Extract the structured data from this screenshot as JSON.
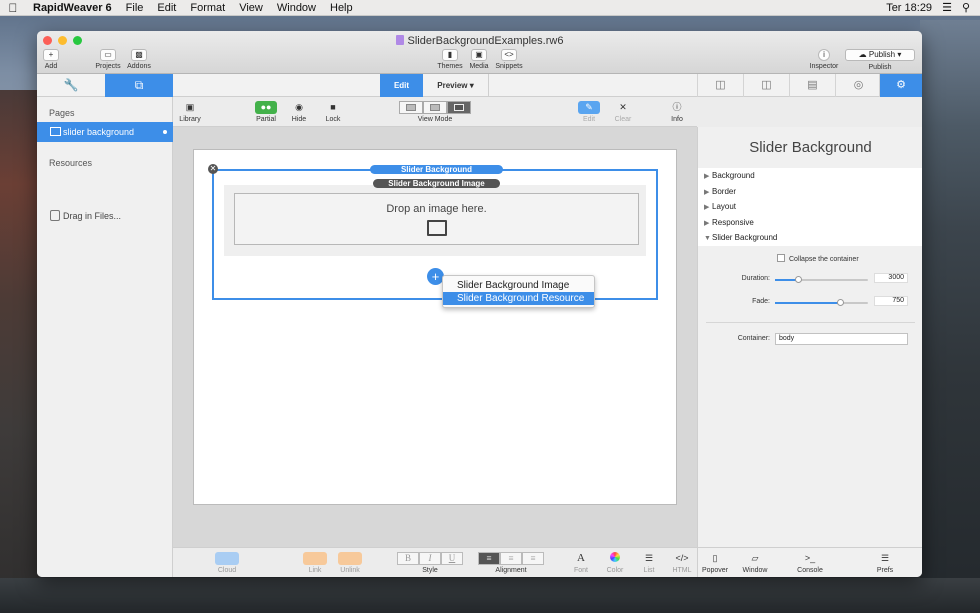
{
  "menubar": {
    "app": "RapidWeaver 6",
    "items": [
      "File",
      "Edit",
      "Format",
      "View",
      "Window",
      "Help"
    ],
    "clock": "Ter 18:29"
  },
  "window": {
    "title": "SliderBackgroundExamples.rw6"
  },
  "toolbar": {
    "add": "Add",
    "projects": "Projects",
    "addons": "Addons",
    "themes": "Themes",
    "media": "Media",
    "snippets": "Snippets",
    "inspector": "Inspector",
    "publish_btn": "Publish",
    "publish": "Publish"
  },
  "modes": {
    "edit": "Edit",
    "preview": "Preview"
  },
  "edit_toolbar": {
    "library": "Library",
    "partial": "Partial",
    "hide": "Hide",
    "lock": "Lock",
    "view_mode": "View Mode",
    "edit": "Edit",
    "clear": "Clear",
    "info": "Info"
  },
  "sidebar": {
    "pages_header": "Pages",
    "page_item": "slider background",
    "resources_header": "Resources",
    "drag_files": "Drag in Files..."
  },
  "canvas": {
    "stack_label": "Slider Background",
    "image_label": "Slider Background Image",
    "drop_text": "Drop an image here.",
    "plus": "+",
    "menu": [
      "Slider Background Image",
      "Slider Background Resource"
    ]
  },
  "bottom": {
    "cloud": "Cloud",
    "link": "Link",
    "unlink": "Unlink",
    "style": "Style",
    "bold": "B",
    "italic": "I",
    "underline": "U",
    "alignment": "Alignment",
    "font": "Font",
    "color": "Color",
    "list": "List",
    "html": "HTML"
  },
  "inspector": {
    "title": "Slider Background",
    "sections": [
      "Background",
      "Border",
      "Layout",
      "Responsive",
      "Slider Background"
    ],
    "collapse": "Collapse the container",
    "duration_label": "Duration:",
    "duration_value": "3000",
    "duration_level": 0.25,
    "fade_label": "Fade:",
    "fade_value": "750",
    "fade_level": 0.7,
    "container_label": "Container:",
    "container_value": "body",
    "popover": "Popover",
    "window": "Window",
    "console": "Console",
    "prefs": "Prefs"
  },
  "colors": {
    "accent": "#3d8ee8"
  }
}
